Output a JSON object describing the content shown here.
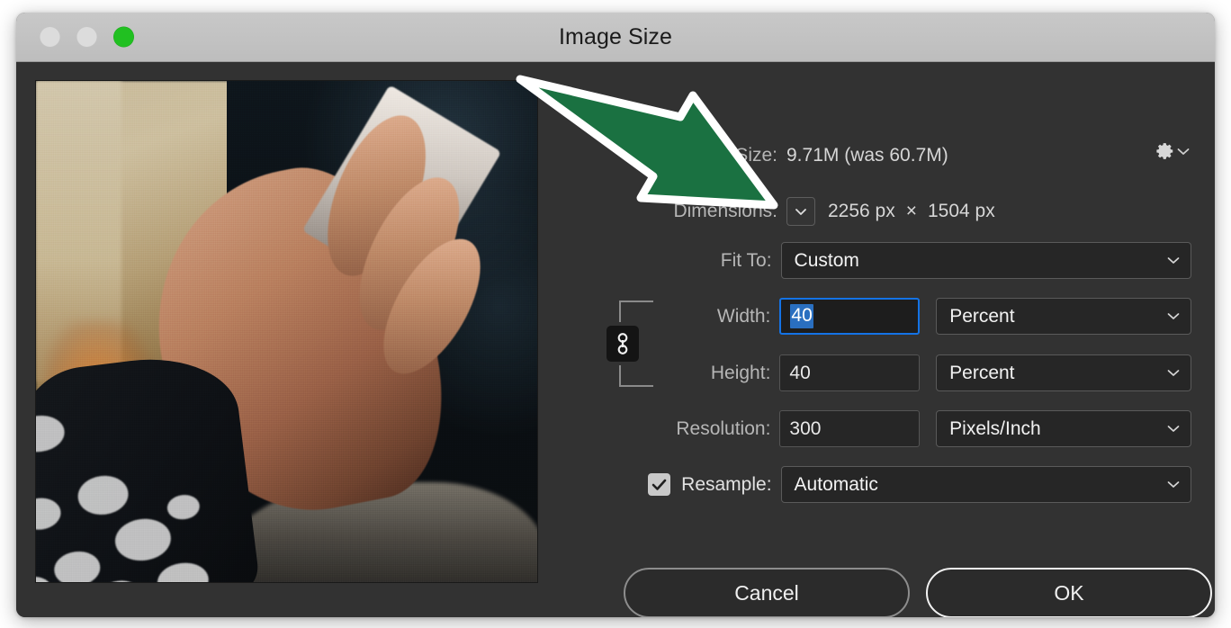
{
  "window": {
    "title": "Image Size",
    "traffic_lights": [
      "close-dot",
      "minimize-dot",
      "zoom-dot-green"
    ]
  },
  "colors": {
    "dialog_bg": "#323232",
    "titlebar_bg": "#c4c4c4",
    "field_bg": "#262626",
    "focus_blue": "#1473e6",
    "selection_blue": "#2a6fc0",
    "annotation_green": "#1a7141",
    "annotation_outline": "#ffffff",
    "green_traffic_light": "#21c021"
  },
  "preview": {
    "alt": "photo of a hand holding a smartphone against a dark background"
  },
  "panel": {
    "gear_icon": "gear-icon",
    "gear_chevron": "chevron-down-icon",
    "image_size": {
      "label": "Image Size:",
      "value": "9.71M (was 60.7M)"
    },
    "dimensions": {
      "label": "Dimensions:",
      "width_value": "2256 px",
      "separator": "×",
      "height_value": "1504 px"
    },
    "fit_to": {
      "label": "Fit To:",
      "value": "Custom"
    },
    "width": {
      "label": "Width:",
      "value": "40",
      "unit": "Percent"
    },
    "height": {
      "label": "Height:",
      "value": "40",
      "unit": "Percent"
    },
    "resolution": {
      "label": "Resolution:",
      "value": "300",
      "unit": "Pixels/Inch"
    },
    "resample": {
      "label": "Resample:",
      "checked": true,
      "value": "Automatic"
    },
    "link_icon": "chain-link-icon"
  },
  "buttons": {
    "cancel": "Cancel",
    "ok": "OK"
  },
  "annotation": {
    "type": "arrow",
    "direction": "down-right",
    "points_to": "width-input"
  }
}
